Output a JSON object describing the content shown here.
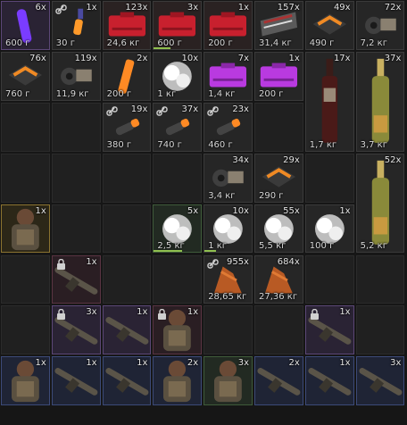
{
  "palette": {
    "background": "#161616",
    "slot": "#202020",
    "durability_bar": "#8fbf4f"
  },
  "items": [
    {
      "name": "purple-chemlight",
      "icon": "purple-glowstick-icon",
      "qty": "6x",
      "weight": "600 г"
    },
    {
      "name": "orange-chemlight",
      "icon": "orange-glowstick-icon",
      "qty": "1x",
      "weight": "30 г",
      "linked": true
    },
    {
      "name": "red-case-1",
      "icon": "red-case-icon",
      "qty": "123x",
      "weight": "24,6 кг"
    },
    {
      "name": "red-case-2",
      "icon": "red-case-icon",
      "qty": "3x",
      "weight": "600 г"
    },
    {
      "name": "red-case-3",
      "icon": "red-case-icon",
      "qty": "1x",
      "weight": "200 г"
    },
    {
      "name": "grey-ammo-box",
      "icon": "ammo-box-icon",
      "qty": "157x",
      "weight": "31,4 кг"
    },
    {
      "name": "orange-toolbox",
      "icon": "toolbox-icon",
      "qty": "49x",
      "weight": "490 г"
    },
    {
      "name": "orange-tape",
      "icon": "tape-icon",
      "qty": "72x",
      "weight": "7,2 кг"
    },
    {
      "name": "green-toolbox",
      "icon": "toolbox-icon",
      "qty": "76x",
      "weight": "760 г"
    },
    {
      "name": "green-tape",
      "icon": "tape-icon",
      "qty": "119x",
      "weight": "11,9 кг"
    },
    {
      "name": "orange-flare-stick",
      "icon": "flare-stick-icon",
      "qty": "2x",
      "weight": "200 г"
    },
    {
      "name": "smoke-puff",
      "icon": "smoke-icon",
      "qty": "10x",
      "weight": "1 кг"
    },
    {
      "name": "purple-case-1",
      "icon": "purple-case-icon",
      "qty": "7x",
      "weight": "1,4 кг"
    },
    {
      "name": "purple-case-2",
      "icon": "purple-case-icon",
      "qty": "1x",
      "weight": "200 г"
    },
    {
      "name": "wine-bottle",
      "icon": "wine-bottle-icon",
      "qty": "17x",
      "weight": "1,7 кг"
    },
    {
      "name": "champagne-bottle",
      "icon": "champagne-bottle-icon",
      "qty": "37x",
      "weight": "3,7 кг"
    },
    {
      "name": "orange-grenade",
      "icon": "grenade-icon",
      "qty": "19x",
      "weight": "380 г",
      "linked": true
    },
    {
      "name": "green-grenade",
      "icon": "grenade-icon",
      "qty": "37x",
      "weight": "740 г",
      "linked": true
    },
    {
      "name": "blue-grenade",
      "icon": "grenade-icon",
      "qty": "23x",
      "weight": "460 г",
      "linked": true
    },
    {
      "name": "tan-tape-roll",
      "icon": "tape-icon",
      "qty": "34x",
      "weight": "3,4 кг"
    },
    {
      "name": "dark-toolbox",
      "icon": "toolbox-icon",
      "qty": "29x",
      "weight": "290 г"
    },
    {
      "name": "champagne-gold-bottle",
      "icon": "champagne-bottle-icon",
      "qty": "52x",
      "weight": "5,2 кг"
    },
    {
      "name": "armored-suit",
      "icon": "armor-icon",
      "qty": "1x"
    },
    {
      "name": "smoke-puff-2",
      "icon": "smoke-icon",
      "qty": "5x",
      "weight": "2,5 кг"
    },
    {
      "name": "smoke-puff-3",
      "icon": "smoke-icon",
      "qty": "10x",
      "weight": "1 кг"
    },
    {
      "name": "smoke-puff-4",
      "icon": "smoke-icon",
      "qty": "55x",
      "weight": "5,5 кг"
    },
    {
      "name": "smoke-puff-5",
      "icon": "smoke-icon",
      "qty": "1x",
      "weight": "100 г"
    },
    {
      "name": "rifle-locked-1",
      "icon": "rifle-icon",
      "qty": "1x",
      "locked": true
    },
    {
      "name": "orange-ore",
      "icon": "ore-icon",
      "qty": "955x",
      "weight": "28,65 кг",
      "linked": true
    },
    {
      "name": "grey-ore",
      "icon": "ore-icon",
      "qty": "684x",
      "weight": "27,36 кг"
    },
    {
      "name": "rifle-locked-2",
      "icon": "rifle-icon",
      "qty": "3x",
      "locked": true
    },
    {
      "name": "rifle-dark",
      "icon": "rifle-icon",
      "qty": "1x"
    },
    {
      "name": "armor-locked",
      "icon": "armor-icon",
      "qty": "1x",
      "locked": true
    },
    {
      "name": "rifle-purple-locked",
      "icon": "rifle-icon",
      "qty": "1x",
      "locked": true
    },
    {
      "name": "armor-blue",
      "icon": "armor-icon",
      "qty": "1x"
    },
    {
      "name": "rifle-blue-1",
      "icon": "rifle-icon",
      "qty": "1x"
    },
    {
      "name": "rifle-blue-2",
      "icon": "rifle-icon",
      "qty": "1x"
    },
    {
      "name": "armor-blue-2",
      "icon": "armor-icon",
      "qty": "2x"
    },
    {
      "name": "armor-green",
      "icon": "armor-icon",
      "qty": "3x"
    },
    {
      "name": "rifle-blue-3",
      "icon": "rifle-icon",
      "qty": "2x"
    },
    {
      "name": "rifle-blue-4",
      "icon": "rifle-icon",
      "qty": "1x"
    },
    {
      "name": "rifle-blue-5",
      "icon": "rifle-icon",
      "qty": "3x"
    }
  ]
}
